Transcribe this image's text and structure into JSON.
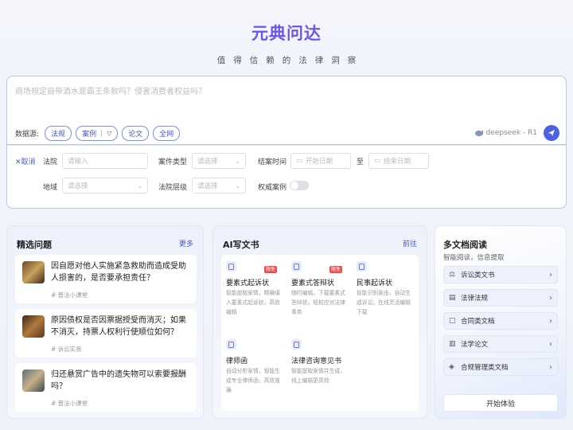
{
  "brand": {
    "name": "元典问达",
    "slogan": "值得信赖的法律洞察"
  },
  "search": {
    "placeholder": "商场规定自带酒水是霸王条款吗？侵害消费者权益吗？",
    "sources_label": "数据源:",
    "sources": [
      "法规",
      "案例",
      "论文",
      "全网"
    ],
    "model": "deepseek - R1"
  },
  "filters": {
    "cancel": "取消",
    "court_label": "法院",
    "court_placeholder": "请输入",
    "case_type_label": "案件类型",
    "case_type_placeholder": "请选择",
    "close_time_label": "结案时间",
    "start_placeholder": "开始日期",
    "to": "至",
    "end_placeholder": "结束日期",
    "region_label": "地域",
    "region_placeholder": "请选择",
    "court_level_label": "法院层级",
    "court_level_placeholder": "请选择",
    "authority_label": "权威案例"
  },
  "featured": {
    "title": "精选问题",
    "more": "更多",
    "items": [
      {
        "text": "因自愿对他人实施紧急救助而造成受助人损害的，是否要承担责任？",
        "tag": "# 普法小课堂"
      },
      {
        "text": "原因债权是否因票据授受而消灭；如果不消灭，持票人权利行使顺位如何？",
        "tag": "# 诉讼实务"
      },
      {
        "text": "归还悬赏广告中的遗失物可以索要报酬吗？",
        "tag": "# 普法小课堂"
      }
    ]
  },
  "ai_docs": {
    "title": "AI写文书",
    "more": "前往",
    "items": [
      {
        "name": "要素式起诉状",
        "badge": "限免",
        "desc": "智能提取案情，精确填入要素式起诉状，高效编辑"
      },
      {
        "name": "要素式答辩状",
        "badge": "限免",
        "desc": "随时编辑，下载要素式答辩状，轻松应对法律事务"
      },
      {
        "name": "民事起诉状",
        "badge": "",
        "desc": "智能识别案由，自动生成诉讼，在线灵活编辑下载"
      },
      {
        "name": "律师函",
        "badge": "",
        "desc": "自动分析案情，智能生成专业律师函，高效准确"
      },
      {
        "name": "法律咨询意见书",
        "badge": "",
        "desc": "智能提取案情并生成，线上编辑更高效"
      }
    ]
  },
  "multi_doc": {
    "title": "多文档阅读",
    "subtitle": "智能阅读，信息提取",
    "items": [
      "诉讼类文书",
      "法律法规",
      "合同类文档",
      "法学论文",
      "合规管理类文档"
    ],
    "start": "开始体验"
  }
}
